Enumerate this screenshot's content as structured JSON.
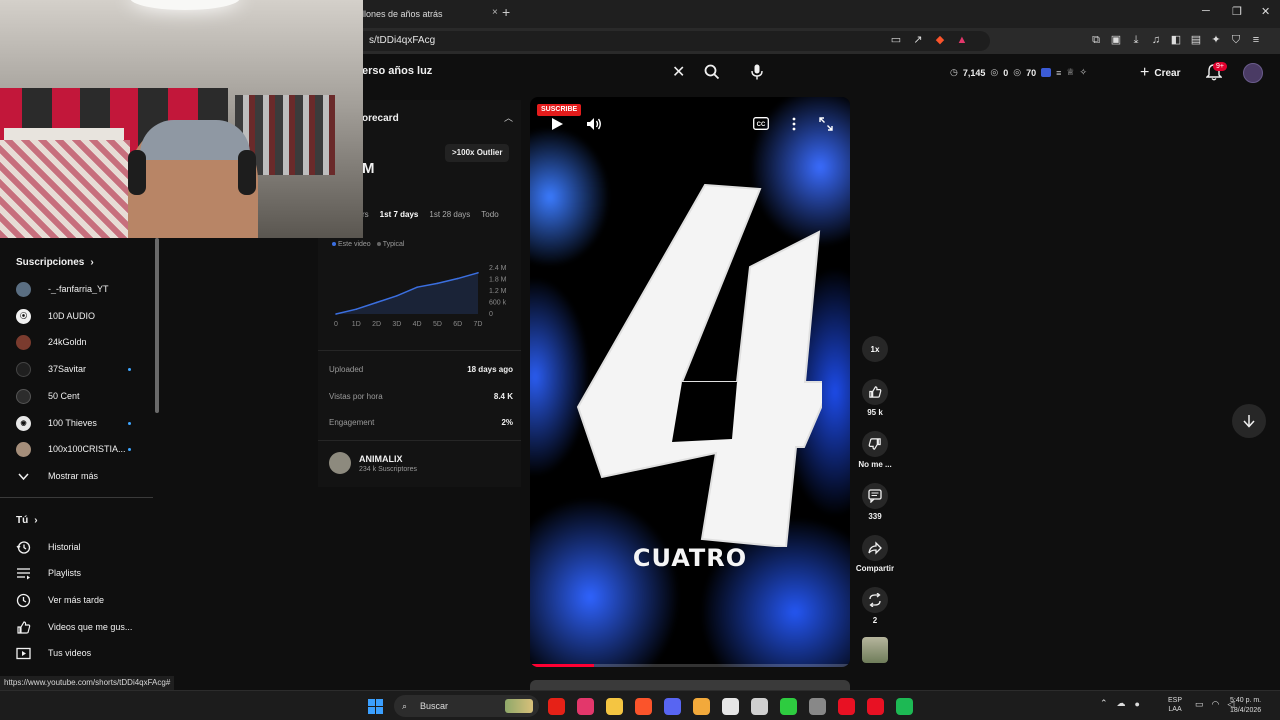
{
  "browser": {
    "tab_title": "llones de años atrás",
    "tab_close": "×",
    "tab_new": "+",
    "window_controls": [
      "─",
      "❐",
      "✕"
    ],
    "url": "s/tDDi4qxFAcg"
  },
  "header": {
    "search_query": "erso años luz",
    "clear_symbol": "✕",
    "stats": {
      "views": "7,145",
      "likes": "0",
      "other": "70"
    },
    "create_label": "Crear",
    "notifications_badge": "9+"
  },
  "sidebar": {
    "subscriptions_title": "Suscripciones",
    "subscriptions": [
      {
        "label": "-_-fanfarria_YT",
        "avatar_color": "#5a6e82",
        "new": false
      },
      {
        "label": "10D AUDIO",
        "avatar_color": "#f1f1f1",
        "new": false
      },
      {
        "label": "24kGoldn",
        "avatar_color": "#7a3b2e",
        "new": false
      },
      {
        "label": "37Savitar",
        "avatar_color": "#1f1f1f",
        "new": true
      },
      {
        "label": "50 Cent",
        "avatar_color": "#2c2c2c",
        "new": false
      },
      {
        "label": "100 Thieves",
        "avatar_color": "#e8e8e8",
        "new": true
      },
      {
        "label": "100x100CRISTIA...",
        "avatar_color": "#a58e7a",
        "new": true
      }
    ],
    "show_more": "Mostrar más",
    "you_title": "Tú",
    "you_items": [
      {
        "label": "Historial",
        "icon": "history-icon"
      },
      {
        "label": "Playlists",
        "icon": "playlists-icon"
      },
      {
        "label": "Ver más tarde",
        "icon": "watch-later-icon"
      },
      {
        "label": "Videos que me gus...",
        "icon": "liked-icon"
      },
      {
        "label": "Tus videos",
        "icon": "your-videos-icon"
      }
    ]
  },
  "panel": {
    "title": "orecard",
    "outlier_badge": ">100x Outlier",
    "big_value": "M",
    "range_tabs": [
      "rs",
      "1st 7 days",
      "1st 28 days",
      "Todo"
    ],
    "active_range": "1st 7 days",
    "legend": [
      {
        "label": "Este video",
        "color": "#3b6fe0"
      },
      {
        "label": "Typical",
        "color": "#666666"
      }
    ],
    "metrics": [
      {
        "label": "Uploaded",
        "value": "18 days ago"
      },
      {
        "label": "Vistas por hora",
        "value": "8.4 K"
      },
      {
        "label": "Engagement",
        "value": "2%"
      }
    ],
    "channel_name": "ANIMALIX",
    "channel_subs": "234 k Suscriptores"
  },
  "chart_data": {
    "type": "line",
    "x": [
      "0",
      "1D",
      "2D",
      "3D",
      "4D",
      "5D",
      "6D",
      "7D"
    ],
    "series": [
      {
        "values": [
          0,
          0.25,
          0.6,
          0.95,
          1.4,
          1.6,
          1.85,
          2.15
        ]
      }
    ],
    "y_ticks": [
      "2.4 M",
      "1.8 M",
      "1.2 M",
      "600 k",
      "0"
    ],
    "ylim": [
      0,
      2.4
    ],
    "grid": false
  },
  "player": {
    "subscribe_badge": "SUSCRIBE",
    "big_text": "4",
    "caption": "CUATRO",
    "progress_fraction": 0.2
  },
  "actions": {
    "speed": "1x",
    "likes": "95 k",
    "dislike_label": "No me ...",
    "comments": "339",
    "share_label": "Compartir",
    "remix_count": "2"
  },
  "status_url": "https://www.youtube.com/shorts/tDDi4qxFAcg#",
  "taskbar": {
    "search_placeholder": "Buscar",
    "lang_top": "ESP",
    "lang_bottom": "LAA",
    "time": "5:40 p. m.",
    "date": "18/4/2026",
    "app_colors": [
      "#e62117",
      "#e3376b",
      "#f4c542",
      "#fb542b",
      "#5865f2",
      "#f2a93b",
      "#e6e6e6",
      "#d0d0d0",
      "#2ecc40",
      "#888888",
      "#e81123",
      "#e81123",
      "#1db954"
    ]
  }
}
